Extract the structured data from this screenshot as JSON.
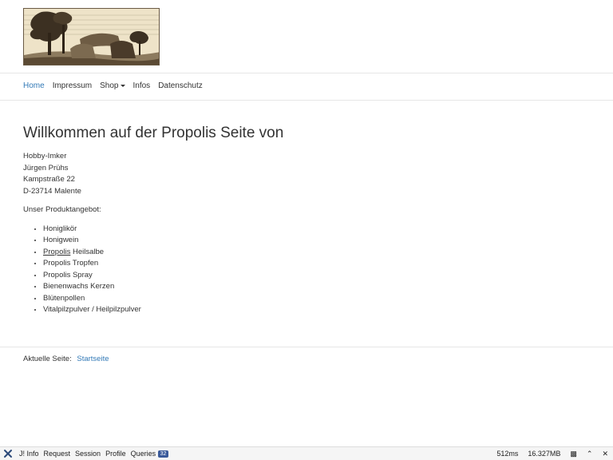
{
  "header": {
    "logo_alt": "dolmen-woodcut-logo"
  },
  "nav": {
    "home": "Home",
    "impressum": "Impressum",
    "shop": "Shop",
    "infos": "Infos",
    "datenschutz": "Datenschutz"
  },
  "main": {
    "heading": "Willkommen auf der Propolis Seite von",
    "address": [
      "Hobby-Imker",
      "Jürgen Prühs",
      "Kampstraße 22",
      "D-23714 Malente"
    ],
    "offer_title": "Unser Produktangebot:",
    "products": [
      "Honiglikör",
      "Honigwein",
      "Heilsalbe",
      "Propolis Tropfen",
      "Propolis Spray",
      "Bienenwachs Kerzen",
      "Blütenpollen",
      "Vitalpilzpulver / Heilpilzpulver"
    ],
    "product_link_word": "Propolis"
  },
  "breadcrumb": {
    "label": "Aktuelle Seite:",
    "current": "Startseite"
  },
  "debugbar": {
    "info": "J! Info",
    "request": "Request",
    "session": "Session",
    "profile": "Profile",
    "queries": "Queries",
    "queries_count": "32",
    "time": "512ms",
    "memory": "16.327MB"
  },
  "colors": {
    "link": "#337ab7",
    "text": "#333333",
    "debug_badge": "#3a5a9a"
  }
}
